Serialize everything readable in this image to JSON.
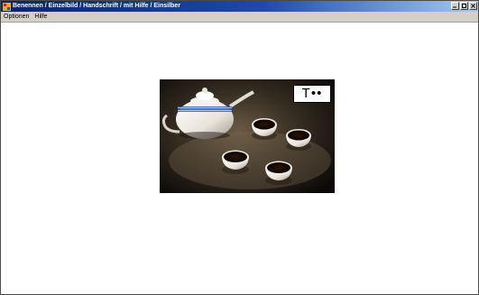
{
  "window": {
    "title": "Benennen / Einzelbild / Handschrift / mit Hilfe / Einsilber",
    "title_bar_color": "#0a246a"
  },
  "menu": {
    "items": [
      {
        "label": "Optionen"
      },
      {
        "label": "Hilfe"
      }
    ]
  },
  "picture": {
    "description_icon": "teapot-with-cups-photo",
    "word_hint": "T••"
  }
}
